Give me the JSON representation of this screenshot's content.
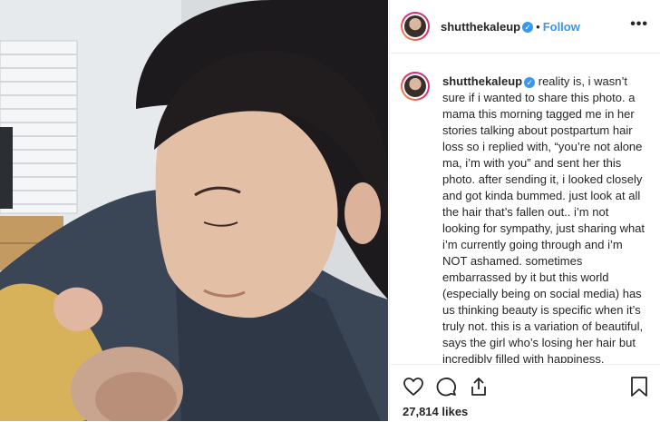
{
  "post": {
    "username": "shutthekaleup",
    "separator": "•",
    "follow_label": "Follow",
    "more_label": "•••",
    "caption": "reality is, i wasn’t sure if i wanted to share this photo. a mama this morning tagged me in her stories talking about postpartum hair loss so i replied with, “you’re not alone ma, i’m with you” and sent her this photo. after sending it, i looked closely and got kinda bummed. just look at all the hair that’s fallen out.. i’m not looking for sympathy, just sharing what i’m currently going through and i’m NOT ashamed. sometimes embarrassed by it but this world (especially being on social media) has us thinking beauty is specific when it’s truly not. this is a variation of beautiful, says the girl who’s losing her hair but incredibly filled with happiness.",
    "likes": "27,814 likes"
  },
  "icons": {
    "verified": "verified-badge-icon",
    "like": "heart-icon",
    "comment": "comment-icon",
    "share": "share-icon",
    "save": "bookmark-icon"
  },
  "colors": {
    "link": "#3897f0",
    "text": "#262626",
    "border": "#efefef"
  }
}
